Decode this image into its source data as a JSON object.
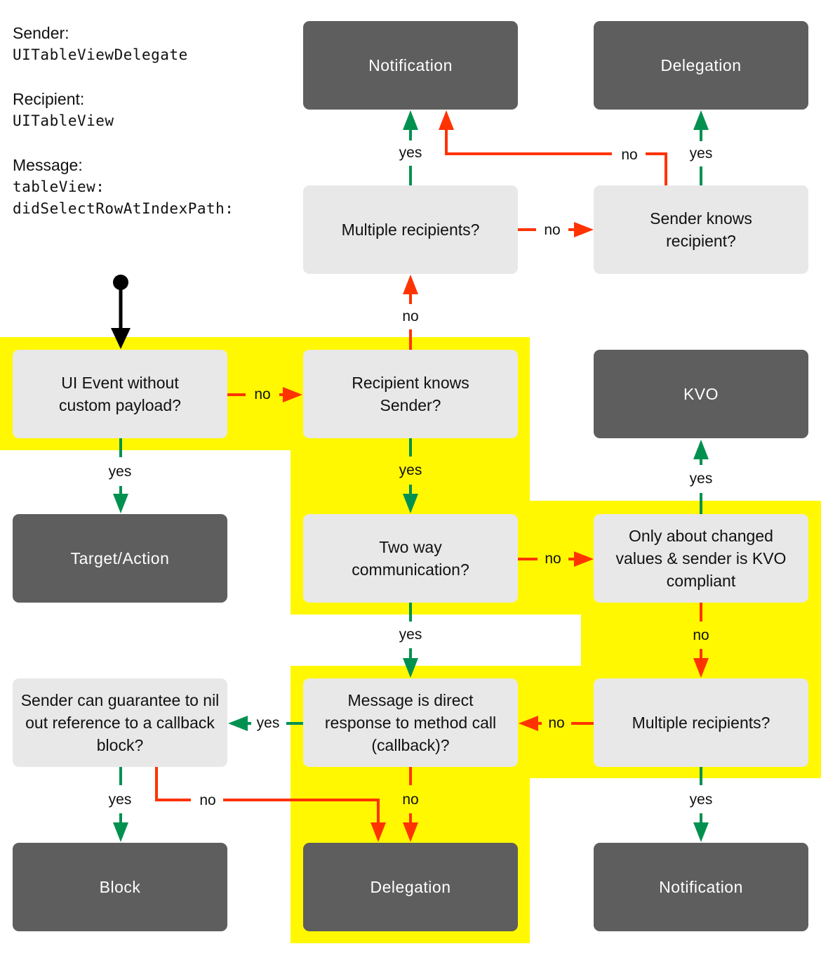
{
  "context": {
    "sender_label": "Sender:",
    "sender_value": "UITableViewDelegate",
    "recipient_label": "Recipient:",
    "recipient_value": "UITableView",
    "message_label": "Message:",
    "message_value_1": "tableView:",
    "message_value_2": "didSelectRowAtIndexPath:"
  },
  "colors": {
    "highlight": "#fff800",
    "question_box": "#e8e8e8",
    "result_box": "#5e5e5e",
    "yes_edge": "#009150",
    "no_edge": "#ff3300",
    "start_edge": "#000000"
  },
  "nodes": {
    "ui_event": {
      "type": "question",
      "text": "UI Event without custom payload?",
      "highlighted": true
    },
    "recipient_knows_sender": {
      "type": "question",
      "text": "Recipient knows Sender?",
      "highlighted": true
    },
    "multiple_recipients_top": {
      "type": "question",
      "text": "Multiple recipients?",
      "highlighted": false
    },
    "sender_knows_recipient": {
      "type": "question",
      "text": "Sender knows recipient?",
      "highlighted": false
    },
    "two_way": {
      "type": "question",
      "text": "Two way communication?",
      "highlighted": true
    },
    "only_changed_values": {
      "type": "question",
      "text": "Only about changed values & sender is KVO compliant",
      "highlighted": true
    },
    "direct_response": {
      "type": "question",
      "text": "Message is direct response to method call (callback)?",
      "highlighted": true
    },
    "multiple_recipients_bottom": {
      "type": "question",
      "text": "Multiple recipients?",
      "highlighted": true
    },
    "sender_nil_out": {
      "type": "question",
      "text": "Sender can guarantee to nil out reference to a callback block?",
      "highlighted": false
    },
    "notification_top": {
      "type": "result",
      "text": "Notification",
      "highlighted": false
    },
    "delegation_top": {
      "type": "result",
      "text": "Delegation",
      "highlighted": false
    },
    "kvo": {
      "type": "result",
      "text": "KVO",
      "highlighted": false
    },
    "target_action": {
      "type": "result",
      "text": "Target/Action",
      "highlighted": false
    },
    "block": {
      "type": "result",
      "text": "Block",
      "highlighted": false
    },
    "delegation_bottom": {
      "type": "result",
      "text": "Delegation",
      "highlighted": true
    },
    "notification_bottom": {
      "type": "result",
      "text": "Notification",
      "highlighted": false
    }
  },
  "edges": [
    {
      "from": "start",
      "to": "ui_event",
      "label": ""
    },
    {
      "from": "ui_event",
      "to": "recipient_knows_sender",
      "label": "no",
      "kind": "no"
    },
    {
      "from": "ui_event",
      "to": "target_action",
      "label": "yes",
      "kind": "yes"
    },
    {
      "from": "recipient_knows_sender",
      "to": "multiple_recipients_top",
      "label": "no",
      "kind": "no"
    },
    {
      "from": "recipient_knows_sender",
      "to": "two_way",
      "label": "yes",
      "kind": "yes"
    },
    {
      "from": "multiple_recipients_top",
      "to": "notification_top",
      "label": "yes",
      "kind": "yes"
    },
    {
      "from": "multiple_recipients_top",
      "to": "sender_knows_recipient",
      "label": "no",
      "kind": "no"
    },
    {
      "from": "sender_knows_recipient",
      "to": "delegation_top",
      "label": "yes",
      "kind": "yes"
    },
    {
      "from": "sender_knows_recipient",
      "to": "notification_top",
      "label": "no",
      "kind": "no"
    },
    {
      "from": "two_way",
      "to": "only_changed_values",
      "label": "no",
      "kind": "no"
    },
    {
      "from": "two_way",
      "to": "direct_response",
      "label": "yes",
      "kind": "yes"
    },
    {
      "from": "only_changed_values",
      "to": "kvo",
      "label": "yes",
      "kind": "yes"
    },
    {
      "from": "only_changed_values",
      "to": "multiple_recipients_bottom",
      "label": "no",
      "kind": "no"
    },
    {
      "from": "multiple_recipients_bottom",
      "to": "direct_response",
      "label": "no",
      "kind": "no"
    },
    {
      "from": "multiple_recipients_bottom",
      "to": "notification_bottom",
      "label": "yes",
      "kind": "yes"
    },
    {
      "from": "direct_response",
      "to": "sender_nil_out",
      "label": "yes",
      "kind": "yes"
    },
    {
      "from": "direct_response",
      "to": "delegation_bottom",
      "label": "no",
      "kind": "no"
    },
    {
      "from": "sender_nil_out",
      "to": "block",
      "label": "yes",
      "kind": "yes"
    },
    {
      "from": "sender_nil_out",
      "to": "delegation_bottom",
      "label": "no",
      "kind": "no"
    }
  ]
}
